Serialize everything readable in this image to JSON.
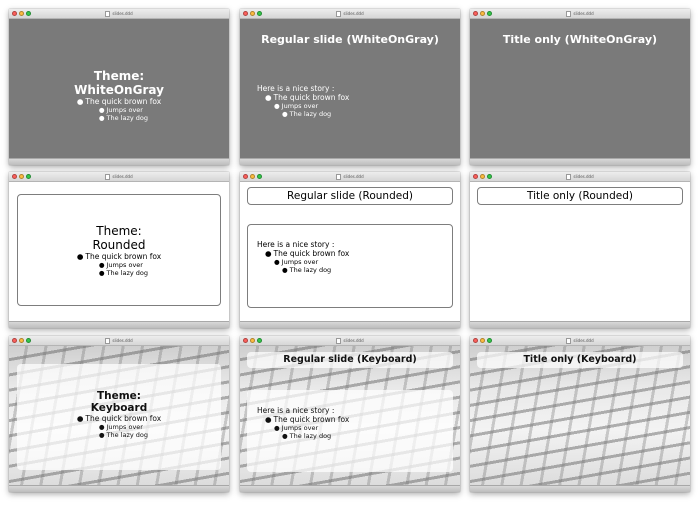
{
  "window_title": "slides.ddd",
  "story": {
    "intro": "Here is a nice story :",
    "bullet_marker": "●",
    "item1": "The quick brown fox",
    "item2": "Jumps over",
    "item3": "The lazy dog"
  },
  "themes": {
    "whiteongray": {
      "title_label": "Theme:",
      "title_name": "WhiteOnGray",
      "regular": "Regular slide (WhiteOnGray)",
      "title_only": "Title only (WhiteOnGray)"
    },
    "rounded": {
      "title_label": "Theme:",
      "title_name": "Rounded",
      "regular": "Regular slide (Rounded)",
      "title_only": "Title only (Rounded)"
    },
    "keyboard": {
      "title_label": "Theme:",
      "title_name": "Keyboard",
      "regular": "Regular slide (Keyboard)",
      "title_only": "Title only (Keyboard)"
    }
  },
  "colors": {
    "gray_bg": "#7a7a7a",
    "close": "#fc605c",
    "minimize": "#fdbc40",
    "zoom": "#34c84a"
  }
}
